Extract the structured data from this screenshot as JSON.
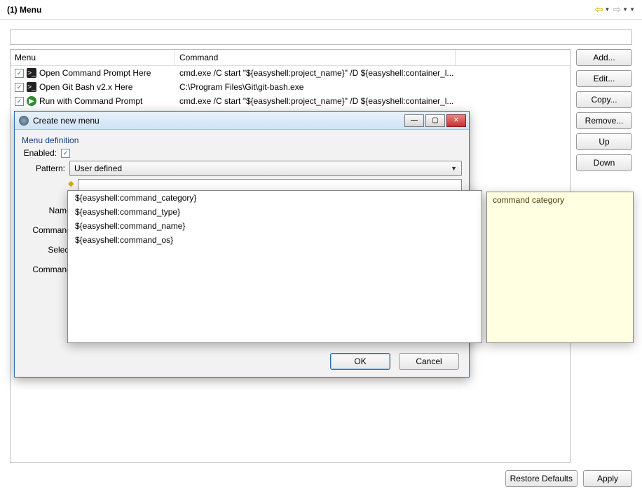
{
  "titlebar": {
    "title": "(1) Menu"
  },
  "table": {
    "columns": {
      "menu": "Menu",
      "command": "Command"
    },
    "rows": [
      {
        "checked": true,
        "icon": "terminal",
        "menu": "Open Command Prompt Here",
        "command": "cmd.exe /C start \"${easyshell:project_name}\" /D ${easyshell:container_l..."
      },
      {
        "checked": true,
        "icon": "terminal",
        "menu": "Open Git Bash v2.x Here",
        "command": "C:\\Program Files\\Git\\git-bash.exe"
      },
      {
        "checked": true,
        "icon": "run",
        "menu": "Run with Command Prompt",
        "command": "cmd.exe /C start \"${easyshell:project_name}\" /D ${easyshell:container_l..."
      }
    ]
  },
  "buttons": {
    "add": "Add...",
    "edit": "Edit...",
    "copy": "Copy...",
    "remove": "Remove...",
    "up": "Up",
    "down": "Down",
    "restore": "Restore Defaults",
    "apply": "Apply"
  },
  "dialog": {
    "title": "Create new menu",
    "section": "Menu definition",
    "labels": {
      "enabled": "Enabled:",
      "pattern": "Pattern:",
      "name": "Name:",
      "command": "Command:",
      "select": "Select:",
      "command2": "Command:"
    },
    "pattern_value": "User defined",
    "ok": "OK",
    "cancel": "Cancel"
  },
  "autocomplete": {
    "items": [
      "${easyshell:command_category}",
      "${easyshell:command_type}",
      "${easyshell:command_name}",
      "${easyshell:command_os}"
    ]
  },
  "tooltip": {
    "text": "command category"
  }
}
